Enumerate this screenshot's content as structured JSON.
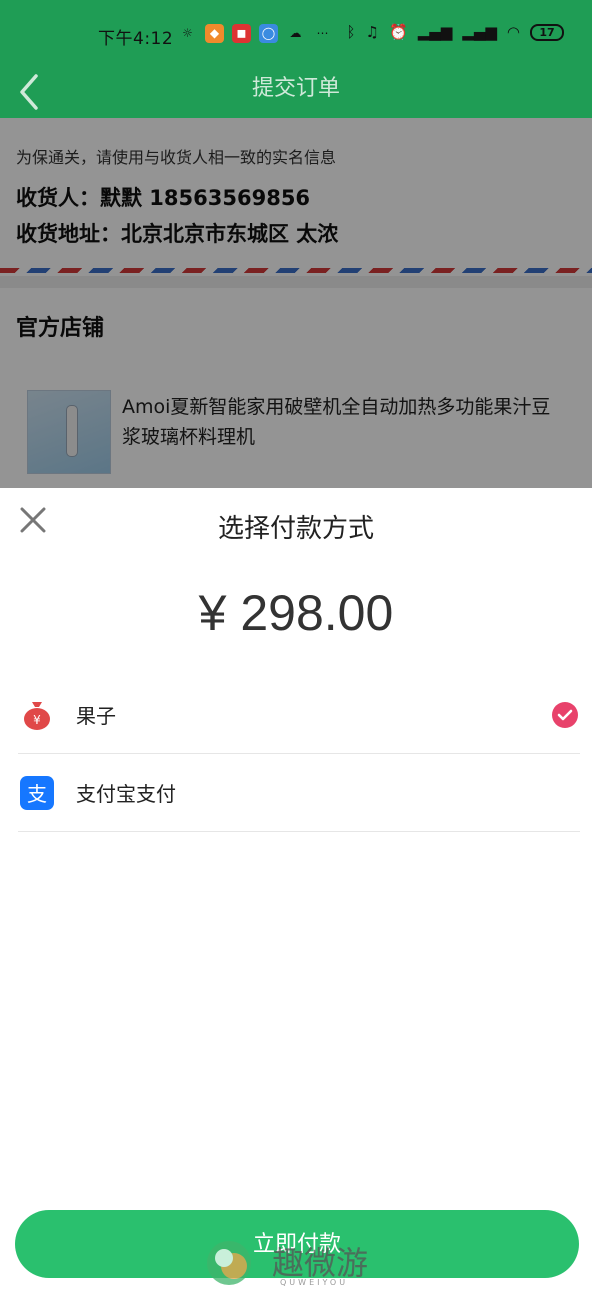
{
  "status_bar": {
    "time": "下午4:12",
    "battery": "17"
  },
  "header": {
    "title": "提交订单"
  },
  "order": {
    "notice": "为保通关，请使用与收货人相一致的实名信息",
    "receiver": "收货人：默默 18563569856",
    "address": "收货地址：北京北京市东城区 太浓",
    "shop_name": "官方店铺",
    "product_name": "Amoi夏新智能家用破壁机全自动加热多功能果汁豆浆玻璃杯料理机"
  },
  "payment_sheet": {
    "title": "选择付款方式",
    "amount": "¥ 298.00",
    "options": [
      {
        "label": "果子",
        "icon": "money-bag-icon",
        "selected": true
      },
      {
        "label": "支付宝支付",
        "icon": "alipay-icon",
        "selected": false
      }
    ],
    "pay_button_label": "立即付款"
  },
  "watermark": {
    "text": "趣微游",
    "subtext": "QUWEIYOU"
  },
  "colors": {
    "header_green": "#1f9d55",
    "button_green": "#2ac06e",
    "check_pink": "#e8426b",
    "alipay_blue": "#1677ff"
  }
}
